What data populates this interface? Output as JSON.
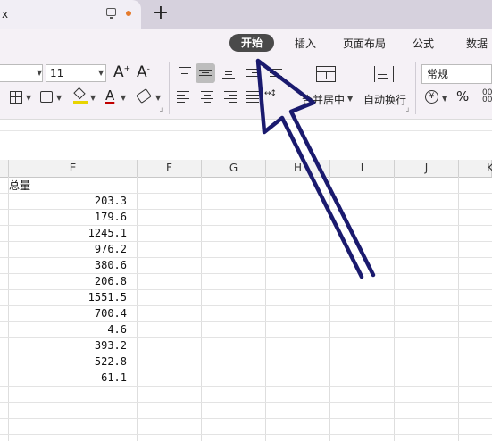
{
  "titlebar": {
    "tab_label": "x",
    "new_tab": "+"
  },
  "ribbon": {
    "tabs": [
      "开始",
      "插入",
      "页面布局",
      "公式",
      "数据"
    ],
    "font_size": "11",
    "font_grow": "A",
    "font_grow_sup": "+",
    "font_shrink": "A",
    "font_shrink_sup": "-",
    "font_color_letter": "A",
    "merge_center_label": "合并居中",
    "wrap_text_label": "自动换行",
    "number_format": "常规",
    "currency_symbol": "¥",
    "percent_symbol": "%",
    "accent_color": "#4a4a4a",
    "fill_color": "#e8d400",
    "font_color": "#c00000"
  },
  "grid": {
    "columns": [
      "E",
      "F",
      "G",
      "H",
      "I",
      "J",
      "K"
    ],
    "header_cell": "总量",
    "values": [
      "203.3",
      "179.6",
      "1245.1",
      "976.2",
      "380.6",
      "206.8",
      "1551.5",
      "700.4",
      "4.6",
      "393.2",
      "522.8",
      "61.1"
    ]
  },
  "annotation": {
    "arrow_color": "#1a1a6e"
  }
}
